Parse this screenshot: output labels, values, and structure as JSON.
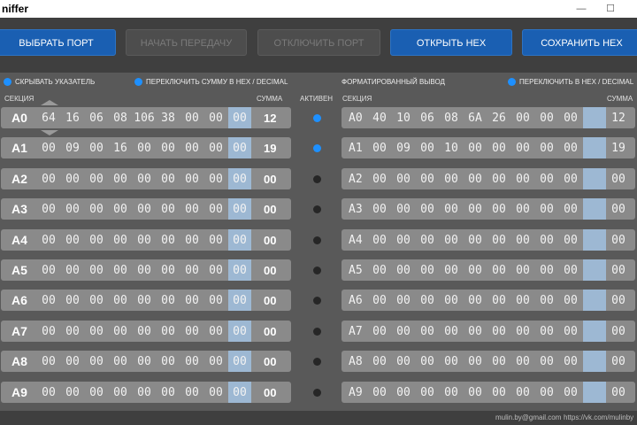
{
  "window": {
    "title": "niffer",
    "minimize": "—",
    "maximize": "☐"
  },
  "toolbar": {
    "buttons": [
      {
        "label": "ВЫБРАТЬ ПОРТ",
        "enabled": true
      },
      {
        "label": "НАЧАТЬ ПЕРЕДАЧУ",
        "enabled": false
      },
      {
        "label": "ОТКЛЮЧИТЬ ПОРТ",
        "enabled": false
      },
      {
        "label": "ОТКРЫТЬ HEX",
        "enabled": true
      },
      {
        "label": "СОХРАНИТЬ HEX",
        "enabled": true
      }
    ]
  },
  "options": {
    "hide_pointer": "СКРЫВАТЬ УКАЗАТЕЛЬ",
    "toggle_sum": "ПЕРЕКЛЮЧИТЬ СУММУ В HEX / DECIMAL",
    "formatted_output": "ФОРМАТИРОВАННЫЙ ВЫВОД",
    "toggle_hex": "ПЕРЕКЛЮЧИТЬ В HEX / DECIMAL"
  },
  "headers": {
    "section_left": "СЕКЦИЯ",
    "sum_left": "СУММА",
    "active": "АКТИВЕН",
    "section_right": "СЕКЦИЯ",
    "sum_right": "СУММА"
  },
  "colors": {
    "accent": "#1e90ff",
    "button": "#1a5fb2",
    "highlight": "#9db8d3"
  },
  "sections": [
    {
      "label": "A0",
      "bytes": [
        "64",
        "16",
        "06",
        "08",
        "106",
        "38",
        "00",
        "00",
        "00"
      ],
      "sum": "12",
      "active": true,
      "fmt": [
        "40",
        "10",
        "06",
        "08",
        "6A",
        "26",
        "00",
        "00",
        "00"
      ],
      "fmt_sum": "12"
    },
    {
      "label": "A1",
      "bytes": [
        "00",
        "09",
        "00",
        "16",
        "00",
        "00",
        "00",
        "00",
        "00"
      ],
      "sum": "19",
      "active": true,
      "fmt": [
        "00",
        "09",
        "00",
        "10",
        "00",
        "00",
        "00",
        "00",
        "00"
      ],
      "fmt_sum": "19"
    },
    {
      "label": "A2",
      "bytes": [
        "00",
        "00",
        "00",
        "00",
        "00",
        "00",
        "00",
        "00",
        "00"
      ],
      "sum": "00",
      "active": false,
      "fmt": [
        "00",
        "00",
        "00",
        "00",
        "00",
        "00",
        "00",
        "00",
        "00"
      ],
      "fmt_sum": "00"
    },
    {
      "label": "A3",
      "bytes": [
        "00",
        "00",
        "00",
        "00",
        "00",
        "00",
        "00",
        "00",
        "00"
      ],
      "sum": "00",
      "active": false,
      "fmt": [
        "00",
        "00",
        "00",
        "00",
        "00",
        "00",
        "00",
        "00",
        "00"
      ],
      "fmt_sum": "00"
    },
    {
      "label": "A4",
      "bytes": [
        "00",
        "00",
        "00",
        "00",
        "00",
        "00",
        "00",
        "00",
        "00"
      ],
      "sum": "00",
      "active": false,
      "fmt": [
        "00",
        "00",
        "00",
        "00",
        "00",
        "00",
        "00",
        "00",
        "00"
      ],
      "fmt_sum": "00"
    },
    {
      "label": "A5",
      "bytes": [
        "00",
        "00",
        "00",
        "00",
        "00",
        "00",
        "00",
        "00",
        "00"
      ],
      "sum": "00",
      "active": false,
      "fmt": [
        "00",
        "00",
        "00",
        "00",
        "00",
        "00",
        "00",
        "00",
        "00"
      ],
      "fmt_sum": "00"
    },
    {
      "label": "A6",
      "bytes": [
        "00",
        "00",
        "00",
        "00",
        "00",
        "00",
        "00",
        "00",
        "00"
      ],
      "sum": "00",
      "active": false,
      "fmt": [
        "00",
        "00",
        "00",
        "00",
        "00",
        "00",
        "00",
        "00",
        "00"
      ],
      "fmt_sum": "00"
    },
    {
      "label": "A7",
      "bytes": [
        "00",
        "00",
        "00",
        "00",
        "00",
        "00",
        "00",
        "00",
        "00"
      ],
      "sum": "00",
      "active": false,
      "fmt": [
        "00",
        "00",
        "00",
        "00",
        "00",
        "00",
        "00",
        "00",
        "00"
      ],
      "fmt_sum": "00"
    },
    {
      "label": "A8",
      "bytes": [
        "00",
        "00",
        "00",
        "00",
        "00",
        "00",
        "00",
        "00",
        "00"
      ],
      "sum": "00",
      "active": false,
      "fmt": [
        "00",
        "00",
        "00",
        "00",
        "00",
        "00",
        "00",
        "00",
        "00"
      ],
      "fmt_sum": "00"
    },
    {
      "label": "A9",
      "bytes": [
        "00",
        "00",
        "00",
        "00",
        "00",
        "00",
        "00",
        "00",
        "00"
      ],
      "sum": "00",
      "active": false,
      "fmt": [
        "00",
        "00",
        "00",
        "00",
        "00",
        "00",
        "00",
        "00",
        "00"
      ],
      "fmt_sum": "00"
    }
  ],
  "footer": {
    "email": "mulin.by@gmail.com",
    "vk": "https://vk.com/mulinby"
  }
}
